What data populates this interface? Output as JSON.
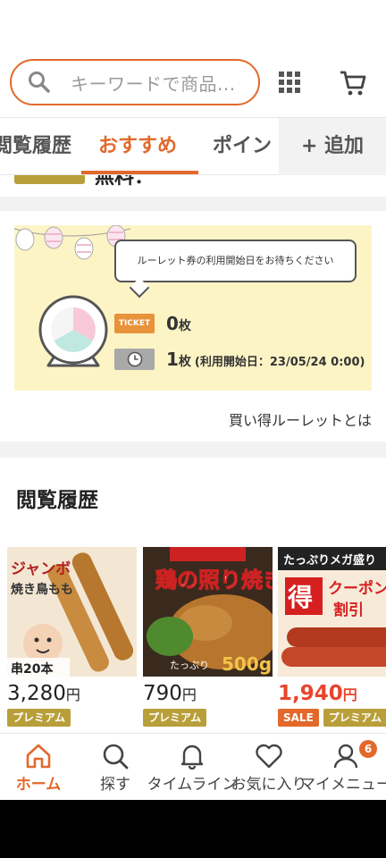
{
  "header": {
    "search_placeholder": "キーワードで商品..."
  },
  "tabs": [
    {
      "label": "閲覧履歴"
    },
    {
      "label": "おすすめ"
    },
    {
      "label": "ポイン"
    }
  ],
  "tab_add_label": "+ 追加",
  "partial_row_text": "無料：",
  "roulette": {
    "bubble_text": "ルーレット券の利用開始日をお待ちください",
    "ticket_label": "TICKET",
    "ticket_count": "0",
    "ticket_unit": "枚",
    "pending_count": "1",
    "pending_unit": "枚",
    "pending_note": "(利用開始日：23/05/24 0:00)",
    "link_text": "買い得ルーレットとは"
  },
  "history": {
    "title": "閲覧履歴",
    "products": [
      {
        "price": "3,280",
        "yen": "円",
        "badges": [
          "プレミアム"
        ],
        "thumb_text": "ジャンボ焼き鳥もも",
        "thumb_sub": "串20本"
      },
      {
        "price": "790",
        "yen": "円",
        "badges": [
          "プレミアム"
        ],
        "thumb_text": "鶏の照り焼き",
        "thumb_sub": "たっぷり500g"
      },
      {
        "price": "1,940",
        "yen": "円",
        "badges": [
          "SALE",
          "プレミアム"
        ],
        "thumb_text": "たっぷりメガ盛り",
        "thumb_sub": "クーポン割引"
      }
    ]
  },
  "bottom_nav": [
    {
      "label": "ホーム",
      "icon": "home-icon"
    },
    {
      "label": "探す",
      "icon": "search-icon"
    },
    {
      "label": "タイムライン",
      "icon": "bell-icon"
    },
    {
      "label": "お気に入り",
      "icon": "heart-icon"
    },
    {
      "label": "マイメニュー",
      "icon": "user-icon"
    }
  ],
  "notification_count": "6",
  "colors": {
    "accent": "#e2692b",
    "premium": "#b99f3a",
    "sale_price": "#e8452d",
    "roulette_bg": "#fdf4c6"
  }
}
